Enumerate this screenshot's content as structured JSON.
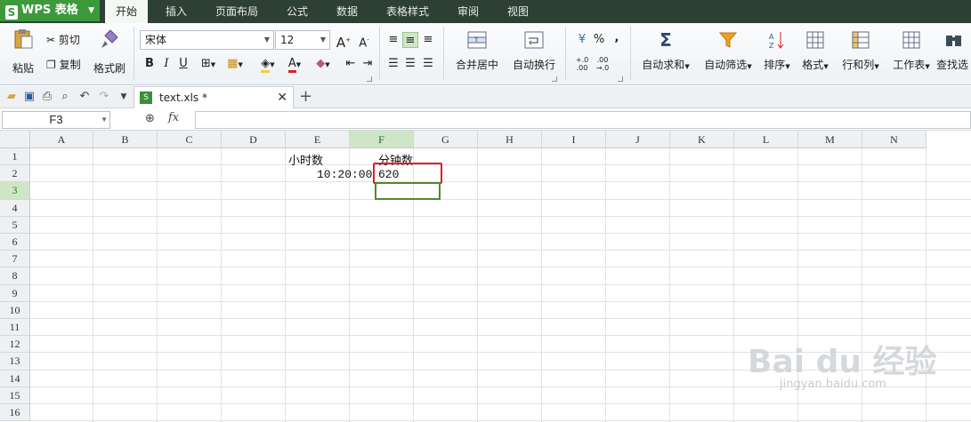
{
  "app": {
    "name": "WPS 表格",
    "logo": "S"
  },
  "menu_tabs": [
    "开始",
    "插入",
    "页面布局",
    "公式",
    "数据",
    "表格样式",
    "审阅",
    "视图"
  ],
  "active_tab": "开始",
  "ribbon": {
    "paste": "粘贴",
    "cut": "剪切",
    "copy": "复制",
    "format_painter": "格式刷",
    "font_name": "宋体",
    "font_size": "12",
    "bold": "B",
    "italic": "I",
    "underline": "U",
    "merge_center": "合并居中",
    "wrap_text": "自动换行",
    "percent": "%",
    "thousands": ",",
    "auto_sum": "自动求和",
    "auto_filter": "自动筛选",
    "sort": "排序",
    "format": "格式",
    "row_col": "行和列",
    "worksheet": "工作表",
    "find": "查找选"
  },
  "document_tab": {
    "name": "text.xls *"
  },
  "formula_bar": {
    "name_box": "F3",
    "fx": "fx",
    "formula": ""
  },
  "sheet": {
    "columns": [
      "A",
      "B",
      "C",
      "D",
      "E",
      "F",
      "G",
      "H",
      "I",
      "J",
      "K",
      "L",
      "M",
      "N"
    ],
    "rows": [
      "1",
      "2",
      "3",
      "4",
      "5",
      "6",
      "7",
      "8",
      "9",
      "10",
      "11",
      "12",
      "13",
      "14",
      "15",
      "16"
    ],
    "selected_col": "F",
    "selected_row": "3",
    "cells": {
      "E1": "小时数",
      "F1": "分钟数",
      "E2": "10:20:00",
      "F2": "620"
    }
  },
  "watermark": {
    "text": "Bai du 经验",
    "sub": "jingyan.baidu.com"
  },
  "colors": {
    "accent_green": "#3c9a3c",
    "selection_green": "#4f8a2c",
    "highlight_red": "#e02020",
    "header_selected": "#cfe6c6"
  }
}
